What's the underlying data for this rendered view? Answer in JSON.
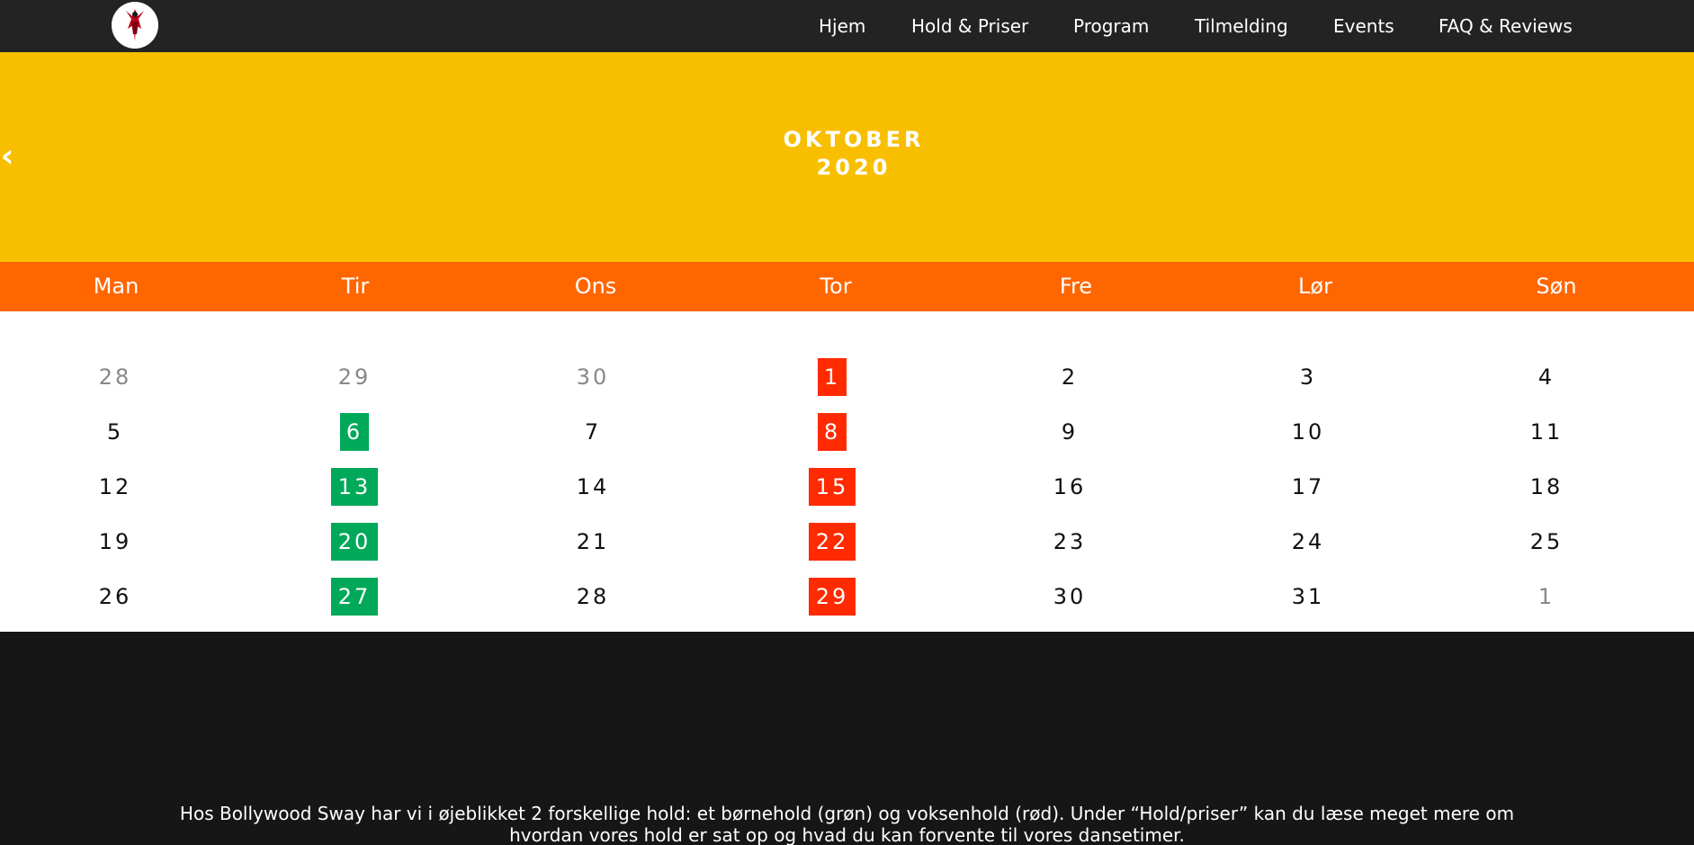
{
  "nav": {
    "logo_alt": "Bollywood Sway logo",
    "items": [
      "Hjem",
      "Hold & Priser",
      "Program",
      "Tilmelding",
      "Events",
      "FAQ & Reviews"
    ]
  },
  "calendar": {
    "prev_symbol": "‹",
    "month": "OKTOBER",
    "year": "2020",
    "weekdays": [
      "Man",
      "Tir",
      "Ons",
      "Tor",
      "Fre",
      "Lør",
      "Søn"
    ],
    "weeks": [
      [
        {
          "d": "28",
          "s": "muted"
        },
        {
          "d": "29",
          "s": "muted"
        },
        {
          "d": "30",
          "s": "muted"
        },
        {
          "d": "1",
          "s": "red"
        },
        {
          "d": "2",
          "s": ""
        },
        {
          "d": "3",
          "s": ""
        },
        {
          "d": "4",
          "s": ""
        }
      ],
      [
        {
          "d": "5",
          "s": ""
        },
        {
          "d": "6",
          "s": "green"
        },
        {
          "d": "7",
          "s": ""
        },
        {
          "d": "8",
          "s": "red"
        },
        {
          "d": "9",
          "s": ""
        },
        {
          "d": "10",
          "s": ""
        },
        {
          "d": "11",
          "s": ""
        }
      ],
      [
        {
          "d": "12",
          "s": ""
        },
        {
          "d": "13",
          "s": "green"
        },
        {
          "d": "14",
          "s": ""
        },
        {
          "d": "15",
          "s": "red"
        },
        {
          "d": "16",
          "s": ""
        },
        {
          "d": "17",
          "s": ""
        },
        {
          "d": "18",
          "s": ""
        }
      ],
      [
        {
          "d": "19",
          "s": ""
        },
        {
          "d": "20",
          "s": "green"
        },
        {
          "d": "21",
          "s": ""
        },
        {
          "d": "22",
          "s": "red"
        },
        {
          "d": "23",
          "s": ""
        },
        {
          "d": "24",
          "s": ""
        },
        {
          "d": "25",
          "s": ""
        }
      ],
      [
        {
          "d": "26",
          "s": ""
        },
        {
          "d": "27",
          "s": "green"
        },
        {
          "d": "28",
          "s": ""
        },
        {
          "d": "29",
          "s": "red"
        },
        {
          "d": "30",
          "s": ""
        },
        {
          "d": "31",
          "s": ""
        },
        {
          "d": "1",
          "s": "muted"
        }
      ]
    ]
  },
  "info": {
    "text": "Hos Bollywood Sway har vi i øjeblikket 2 forskellige hold: et børnehold (grøn) og voksenhold (rød). Under “Hold/priser” kan du læse meget mere om hvordan vores hold er sat op og hvad du kan forvente til vores dansetimer."
  },
  "colors": {
    "topbar": "#232323",
    "hero": "#f8bf00",
    "weekday_bar": "#ff6600",
    "children_class": "#00a85a",
    "adult_class": "#ff2a00",
    "footer": "#161616"
  }
}
